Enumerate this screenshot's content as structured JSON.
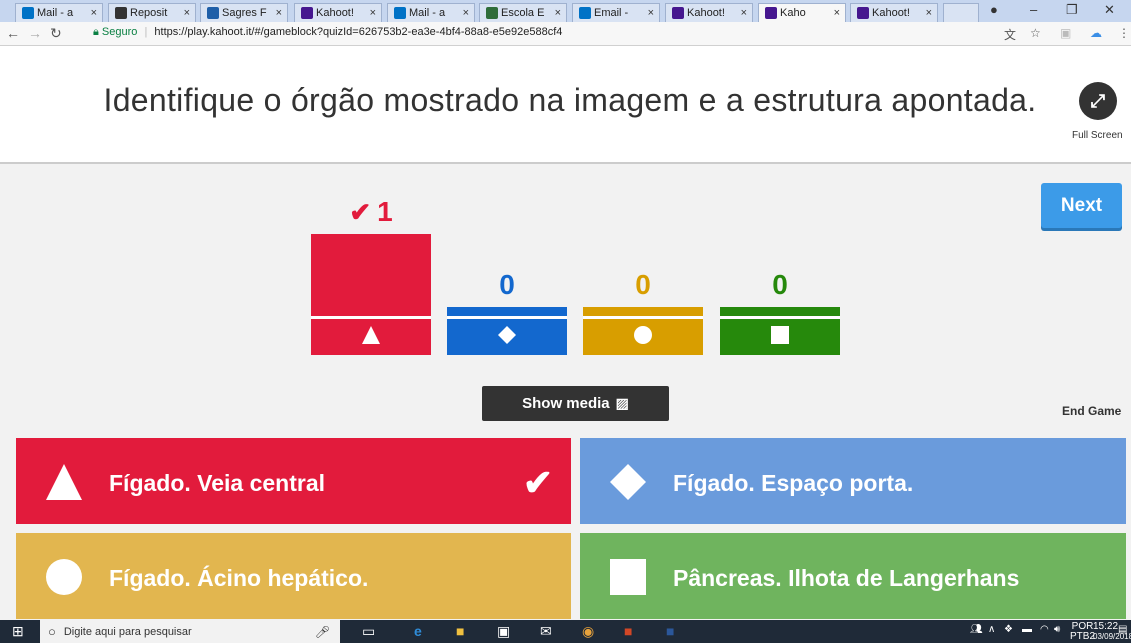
{
  "browser": {
    "tabs": [
      {
        "label": "Mail - a",
        "fav": "o",
        "favcolor": "#0072c6"
      },
      {
        "label": "Reposit",
        "fav": "D",
        "favcolor": "#333"
      },
      {
        "label": "Sagres F",
        "fav": "S",
        "favcolor": "#1f5fa8"
      },
      {
        "label": "Kahoot!",
        "fav": "K!",
        "favcolor": "#46178f"
      },
      {
        "label": "Mail - a",
        "fav": "o",
        "favcolor": "#0072c6"
      },
      {
        "label": "Escola E",
        "fav": "E",
        "favcolor": "#2f6d3a"
      },
      {
        "label": "Email - ",
        "fav": "o",
        "favcolor": "#0072c6"
      },
      {
        "label": "Kahoot!",
        "fav": "K!",
        "favcolor": "#46178f"
      },
      {
        "label": "Kaho",
        "fav": "K!",
        "favcolor": "#46178f"
      },
      {
        "label": "Kahoot!",
        "fav": "K!",
        "favcolor": "#46178f"
      }
    ],
    "secure_label": "Seguro",
    "url": "https://play.kahoot.it/#/gameblock?quizId=626753b2-ea3e-4bf4-88a8-e5e92e588cf4"
  },
  "header": {
    "question": "Identifique o órgão mostrado na imagem e a estrutura apontada.",
    "fullscreen_label": "Full Screen"
  },
  "controls": {
    "next_label": "Next",
    "show_media_label": "Show media",
    "end_game_label": "End Game"
  },
  "results": [
    {
      "count": "1",
      "color": "#e21b3c",
      "text_color": "#e21b3c",
      "shape": "triangle",
      "correct": true
    },
    {
      "count": "0",
      "color": "#1368ce",
      "text_color": "#1368ce",
      "shape": "diamond",
      "correct": false
    },
    {
      "count": "0",
      "color": "#d89e00",
      "text_color": "#d89e00",
      "shape": "circle",
      "correct": false
    },
    {
      "count": "0",
      "color": "#26890c",
      "text_color": "#26890c",
      "shape": "square",
      "correct": false
    }
  ],
  "answers": [
    {
      "label": "Fígado. Veia central",
      "color": "#e21b3c",
      "shape": "triangle",
      "correct": true
    },
    {
      "label": "Fígado. Espaço porta.",
      "color": "#6a9bdc",
      "shape": "diamond",
      "correct": false
    },
    {
      "label": "Fígado. Ácino hepático.",
      "color": "#e2b64f",
      "shape": "circle",
      "correct": false
    },
    {
      "label": "Pâncreas. Ilhota de Langerhans",
      "color": "#6fb45e",
      "shape": "square",
      "correct": false
    }
  ],
  "taskbar": {
    "search_placeholder": "Digite aqui para pesquisar",
    "lang": "POR",
    "lang2": "PTB2",
    "time": "15:22",
    "date": "03/09/2018"
  }
}
